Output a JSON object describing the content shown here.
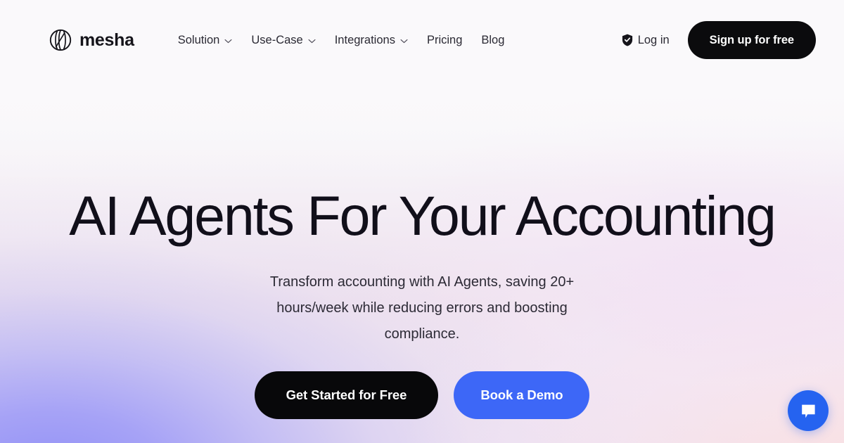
{
  "brand": {
    "name": "mesha",
    "logo_icon": "mesha-mark-icon"
  },
  "header": {
    "nav_items": [
      {
        "label": "Solution",
        "has_dropdown": true,
        "icon": "chevron-down-icon"
      },
      {
        "label": "Use-Case",
        "has_dropdown": true,
        "icon": "chevron-down-icon"
      },
      {
        "label": "Integrations",
        "has_dropdown": true,
        "icon": "chevron-down-icon"
      },
      {
        "label": "Pricing",
        "has_dropdown": false,
        "icon": ""
      },
      {
        "label": "Blog",
        "has_dropdown": false,
        "icon": ""
      }
    ],
    "login": {
      "label": "Log in",
      "icon": "shield-check-icon"
    },
    "signup": {
      "label": "Sign up for free"
    }
  },
  "hero": {
    "title": "AI Agents For Your Accounting",
    "subtitle": "Transform accounting with AI Agents, saving 20+ hours/week while reducing errors and boosting compliance.",
    "primary_cta": "Get Started for Free",
    "secondary_cta": "Book a Demo"
  },
  "chat": {
    "icon": "chat-bubble-icon",
    "aria_label": "Open chat"
  },
  "colors": {
    "ink": "#110f1a",
    "button_dark": "#08080a",
    "accent_blue": "#3d67f7",
    "chat_blue": "#2563f0",
    "bg_top": "#f9f8fa",
    "bg_bottom_left": "#8b8bf6",
    "bg_bottom_right": "#f9e0e2"
  }
}
